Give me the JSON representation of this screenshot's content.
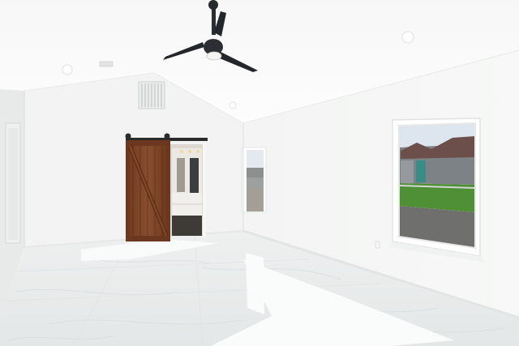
{
  "scene": {
    "description_tags": [
      "room-interior",
      "ceiling-fan",
      "barn-door",
      "windows",
      "marble-floor"
    ],
    "colors": {
      "wall": "#f4f5f4",
      "wall_shade": "#e9ebea",
      "ceiling": "#fbfbfb",
      "floor": "#e9ebeb",
      "barn_door": "#7a4428",
      "barn_door_dark": "#5c3019",
      "fan": "#23262a",
      "lawn": "#4f8f35",
      "street": "#6f6f6d",
      "sky": "#dde6ef",
      "house_roof": "#6c4f4a",
      "house_wall": "#7d8287",
      "house_door": "#3a8c86"
    }
  }
}
